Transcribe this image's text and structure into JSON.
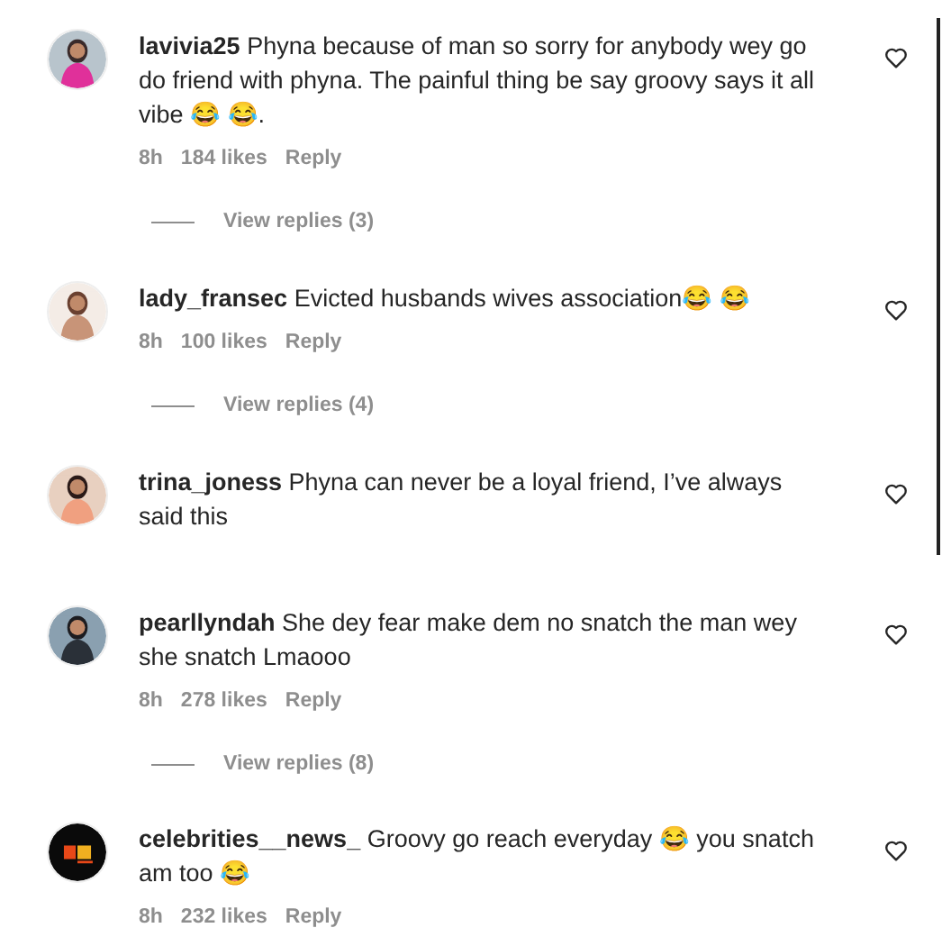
{
  "comments": [
    {
      "username": "lavivia25",
      "text": "Phyna because of man so sorry for anybody wey go do friend with phyna. The painful thing be say groovy says it all vibe 😂 😂.",
      "time": "8h",
      "likes": "184 likes",
      "reply": "Reply",
      "view_replies": "View replies (3)"
    },
    {
      "username": "lady_fransec",
      "text": "Evicted husbands wives association😂 😂",
      "time": "8h",
      "likes": "100 likes",
      "reply": "Reply",
      "view_replies": "View replies (4)"
    },
    {
      "username": "trina_joness",
      "text": "Phyna can never be a loyal friend, I’ve always said this"
    },
    {
      "username": "pearllyndah",
      "text": "She dey fear make dem no snatch the man wey she snatch Lmaooo",
      "time": "8h",
      "likes": "278 likes",
      "reply": "Reply",
      "view_replies": "View replies (8)"
    },
    {
      "username": "celebrities__news_",
      "text": "Groovy go reach everyday 😂 you snatch am too 😂",
      "time": "8h",
      "likes": "232 likes",
      "reply": "Reply"
    }
  ]
}
